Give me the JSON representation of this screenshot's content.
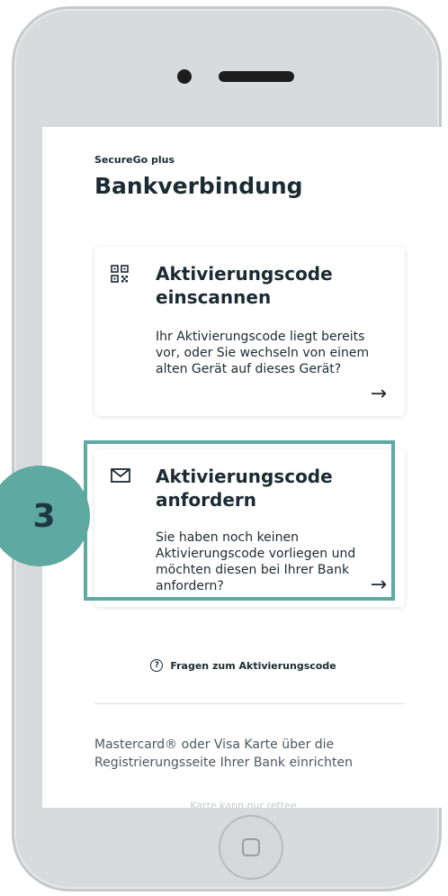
{
  "app": {
    "brand": "SecureGo plus",
    "title": "Bankverbindung"
  },
  "cards": [
    {
      "icon": "qr-code-icon",
      "title": "Aktivierungscode einscannen",
      "description": "Ihr Aktivierungscode liegt bereits vor, oder Sie wechseln von einem alten Gerät auf dieses Gerät?",
      "arrow": "→"
    },
    {
      "icon": "mail-icon",
      "title": "Aktivierungscode anfordern",
      "description": "Sie haben noch keinen Aktivierungscode vorliegen und möchten diesen bei Ihrer Bank anfordern?",
      "arrow": "→"
    }
  ],
  "faq": {
    "icon_glyph": "?",
    "label": "Fragen zum Aktivierungscode"
  },
  "footer": {
    "text": "Mastercard® oder Visa Karte über die Registrierungsseite Ihrer Bank einrichten",
    "faded_link": "Karte kann nur rettee"
  },
  "step": {
    "number": "3"
  },
  "colors": {
    "accent": "#5ea9a1",
    "text": "#1b2b33",
    "step_number": "#1d3845"
  }
}
